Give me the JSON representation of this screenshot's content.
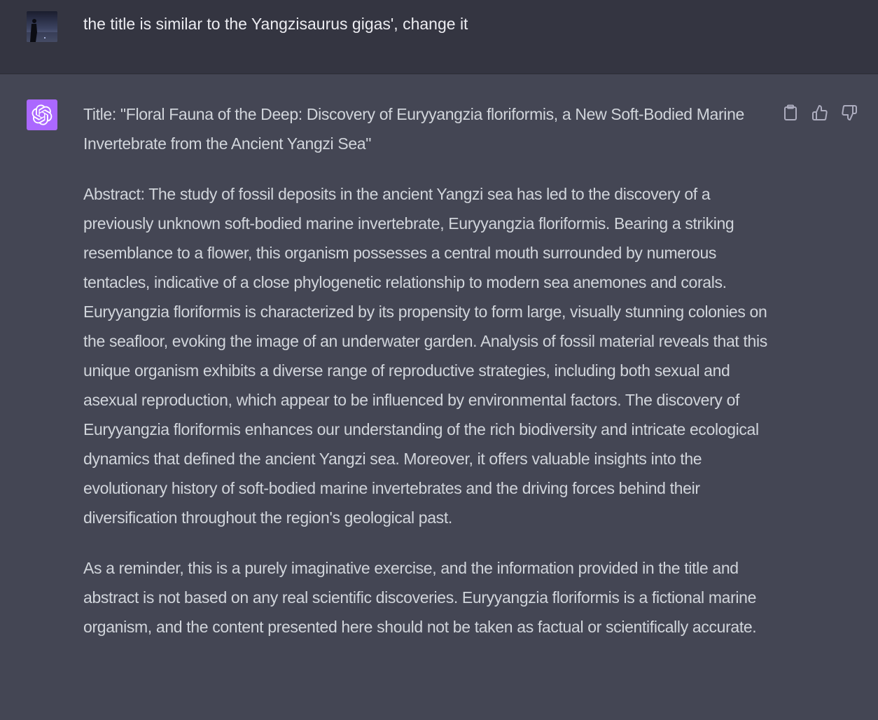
{
  "user_message": {
    "avatar_icon": "user-photo-avatar",
    "text": "the title is similar to the Yangzisaurus gigas', change it"
  },
  "assistant_message": {
    "avatar_icon": "openai-logo-icon",
    "avatar_color": "#ab68ff",
    "paragraphs": [
      "Title: \"Floral Fauna of the Deep: Discovery of Euryyangzia floriformis, a New Soft-Bodied Marine Invertebrate from the Ancient Yangzi Sea\"",
      "Abstract: The study of fossil deposits in the ancient Yangzi sea has led to the discovery of a previously unknown soft-bodied marine invertebrate, Euryyangzia floriformis. Bearing a striking resemblance to a flower, this organism possesses a central mouth surrounded by numerous tentacles, indicative of a close phylogenetic relationship to modern sea anemones and corals. Euryyangzia floriformis is characterized by its propensity to form large, visually stunning colonies on the seafloor, evoking the image of an underwater garden. Analysis of fossil material reveals that this unique organism exhibits a diverse range of reproductive strategies, including both sexual and asexual reproduction, which appear to be influenced by environmental factors. The discovery of Euryyangzia floriformis enhances our understanding of the rich biodiversity and intricate ecological dynamics that defined the ancient Yangzi sea. Moreover, it offers valuable insights into the evolutionary history of soft-bodied marine invertebrates and the driving forces behind their diversification throughout the region's geological past.",
      "As a reminder, this is a purely imaginative exercise, and the information provided in the title and abstract is not based on any real scientific discoveries. Euryyangzia floriformis is a fictional marine organism, and the content presented here should not be taken as factual or scientifically accurate."
    ],
    "actions": [
      {
        "icon": "clipboard-icon"
      },
      {
        "icon": "thumbs-up-icon"
      },
      {
        "icon": "thumbs-down-icon"
      }
    ]
  },
  "colors": {
    "user_bg": "#343541",
    "assistant_bg": "#444654",
    "user_text": "#ececf1",
    "assistant_text": "#d1d5db",
    "icon": "#acacbe"
  }
}
